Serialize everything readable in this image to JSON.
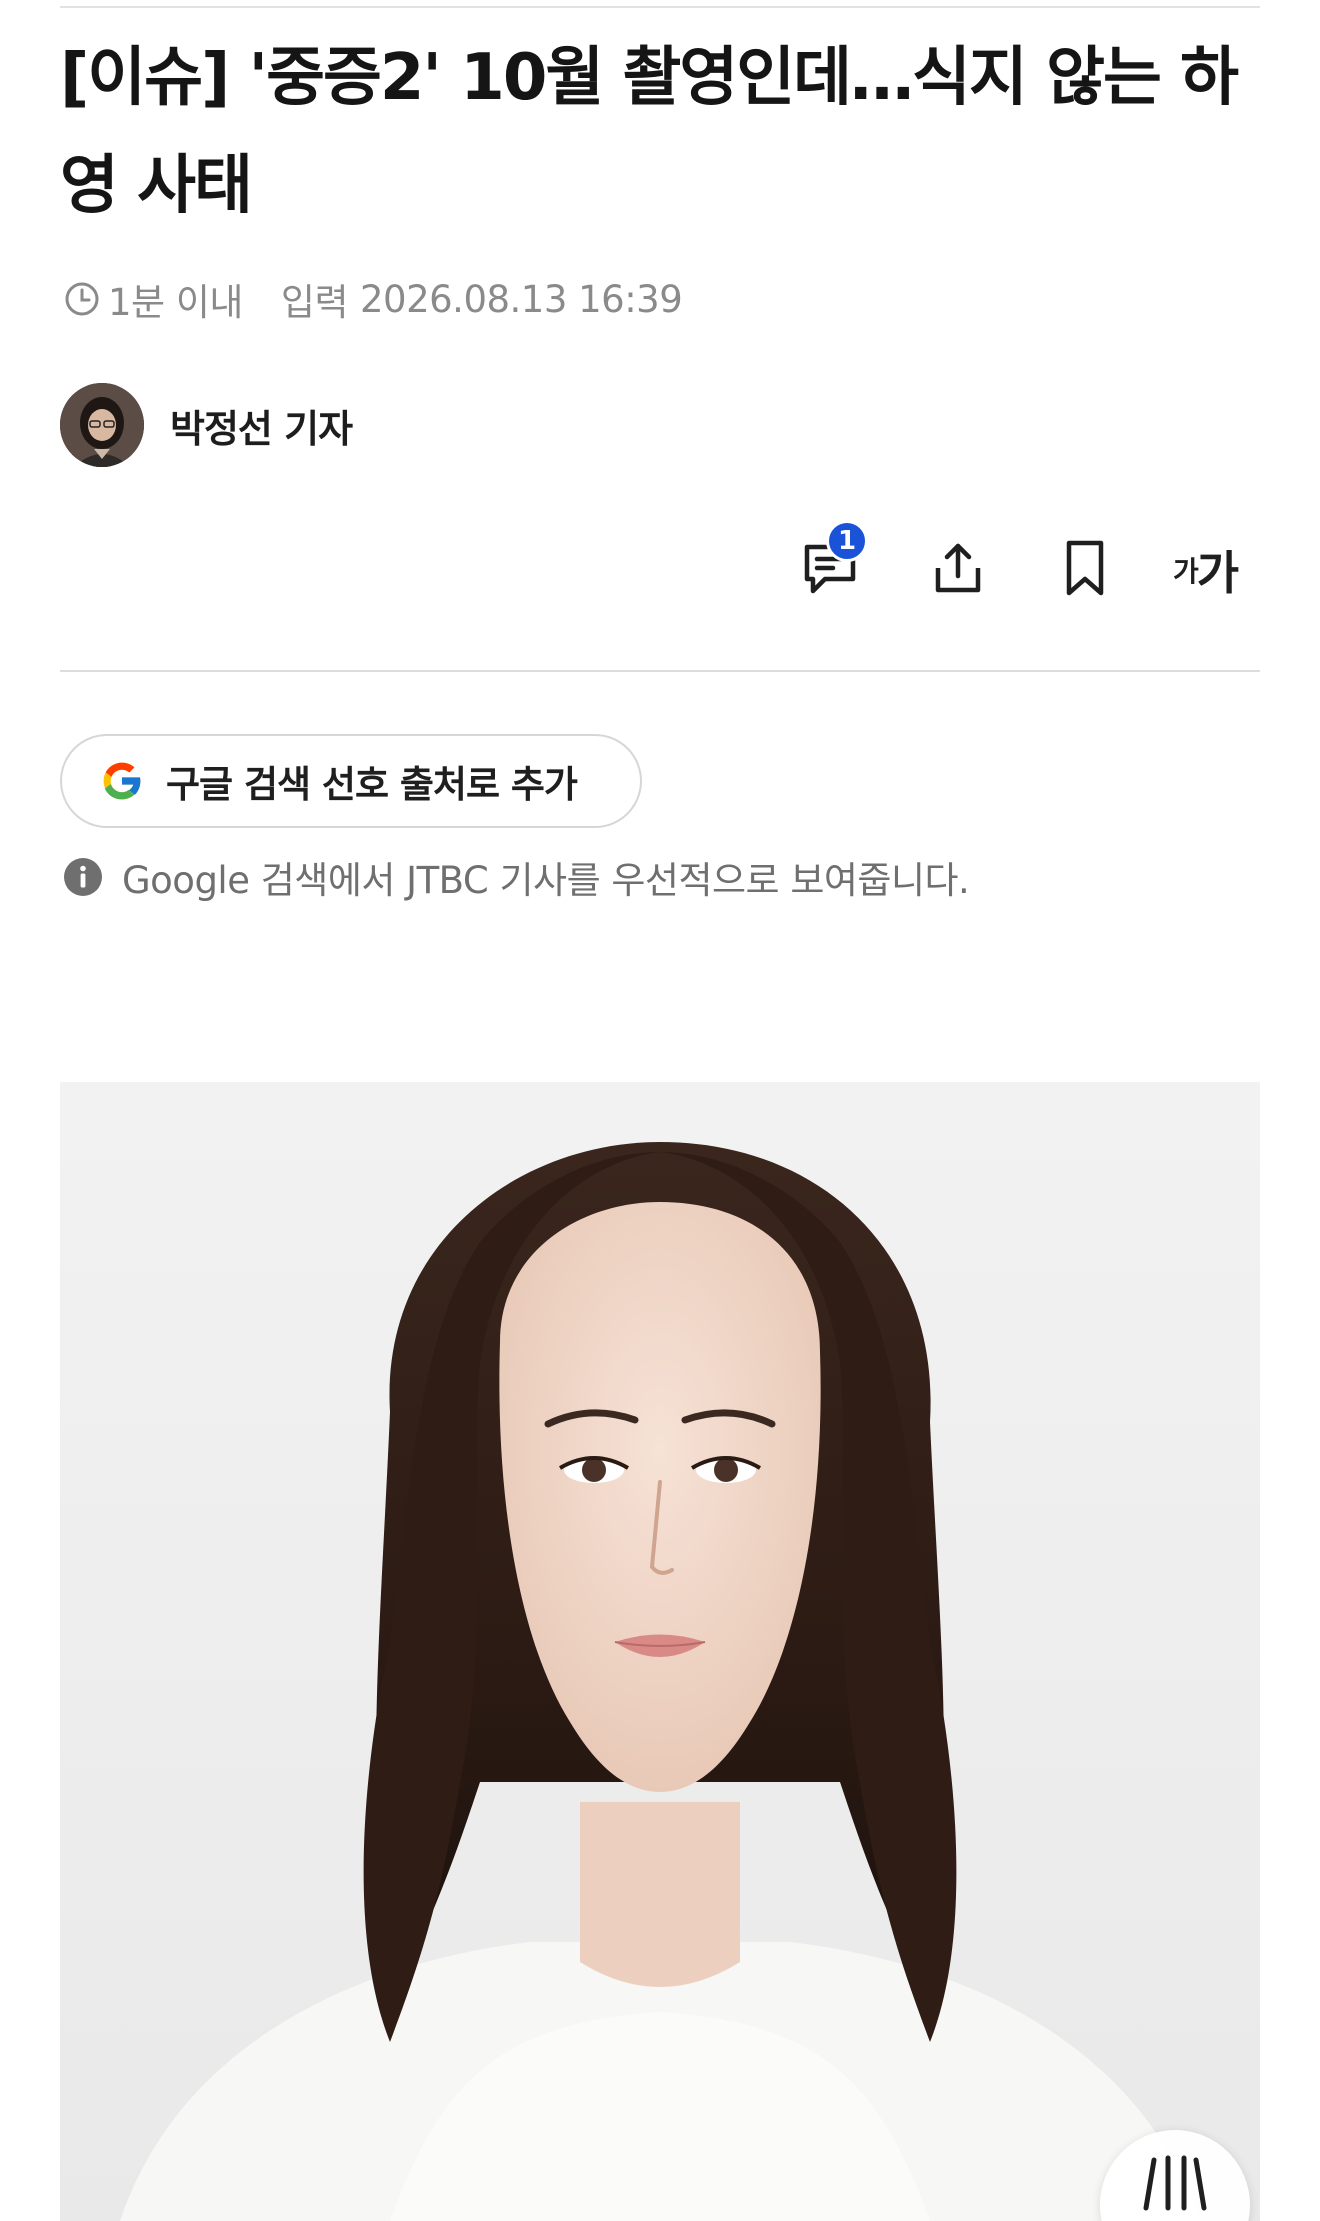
{
  "article": {
    "title": "[이슈] '중증2' 10월 촬영인데…식지 않는 하영 사태",
    "read_time": "1분 이내",
    "input_label": "입력",
    "published": "2026.08.13 16:39"
  },
  "author": {
    "name": "박정선 기자"
  },
  "toolbar": {
    "comment_count": "1",
    "font_small": "가",
    "font_big": "가"
  },
  "google": {
    "button_label": "구글 검색 선호 출처로 추가",
    "info_text": "Google 검색에서 JTBC 기사를 우선적으로 보여줍니다."
  },
  "colors": {
    "accent_blue": "#1a53d8",
    "text_primary": "#151515",
    "text_muted": "#8a8a8a"
  }
}
